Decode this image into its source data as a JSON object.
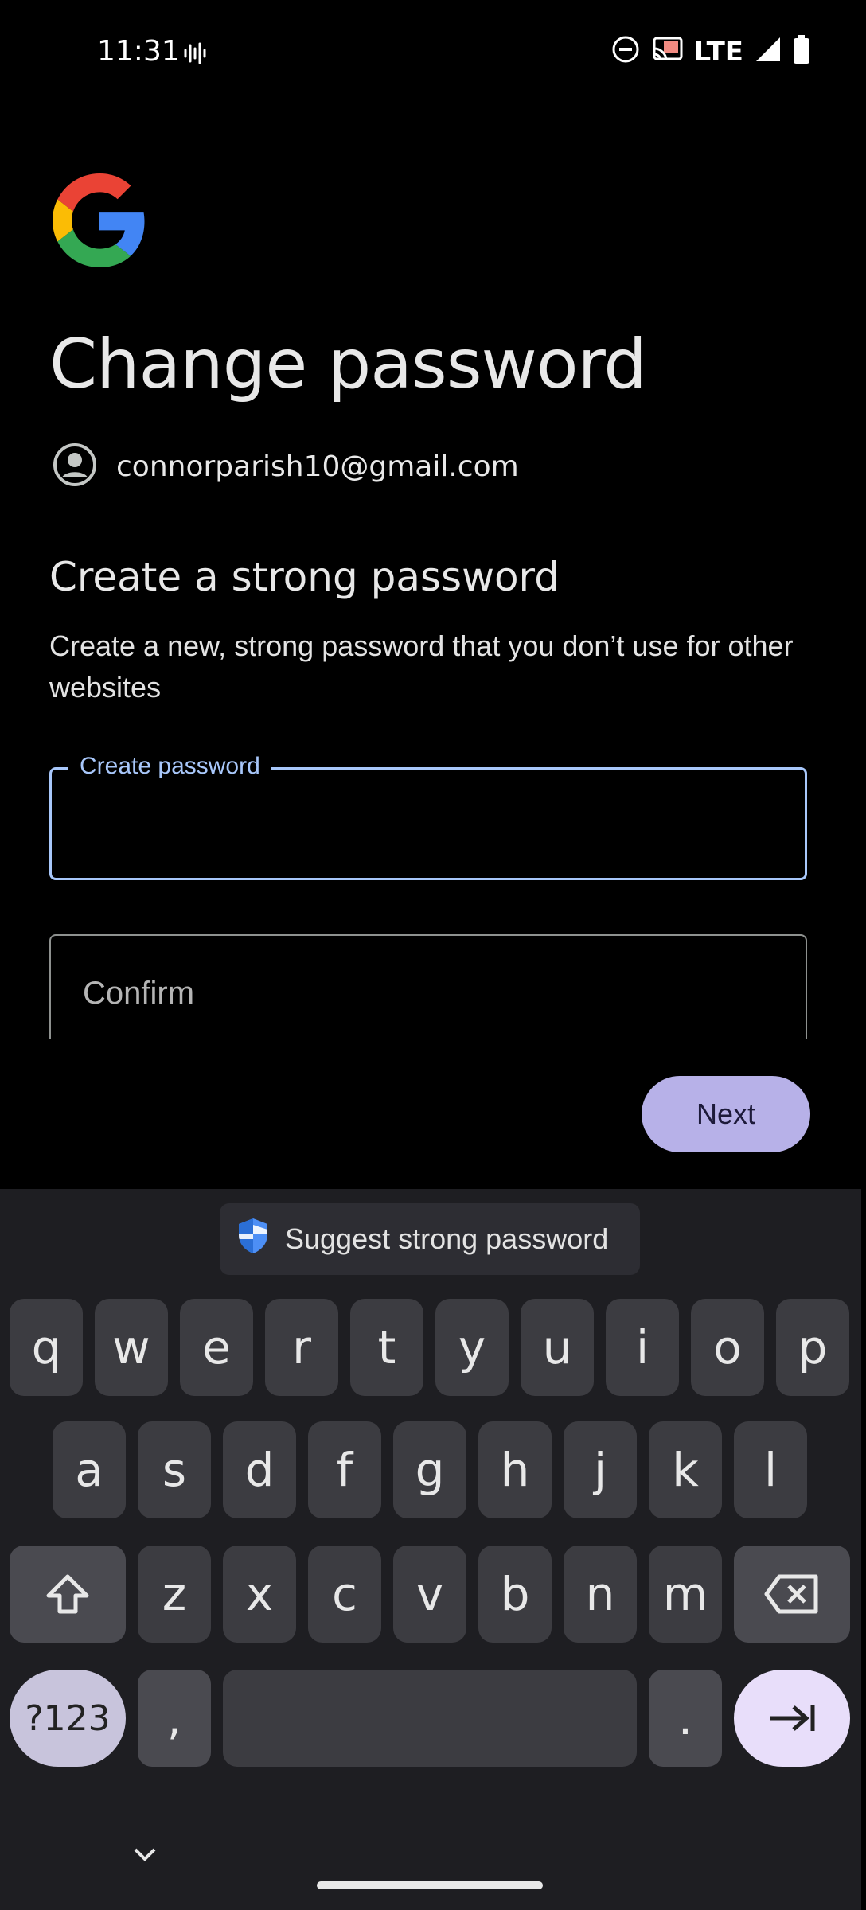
{
  "status": {
    "time": "11:31",
    "network": "LTE"
  },
  "header": {
    "title": "Change password",
    "email": "connorparish10@gmail.com",
    "subtitle": "Create a strong password",
    "description": "Create a new, strong password that you don’t use for other websites"
  },
  "form": {
    "create_label": "Create password",
    "confirm_placeholder": "Confirm",
    "next_label": "Next"
  },
  "keyboard": {
    "suggestion": "Suggest strong password",
    "row1": [
      "q",
      "w",
      "e",
      "r",
      "t",
      "y",
      "u",
      "i",
      "o",
      "p"
    ],
    "row2": [
      "a",
      "s",
      "d",
      "f",
      "g",
      "h",
      "j",
      "k",
      "l"
    ],
    "row3": [
      "z",
      "x",
      "c",
      "v",
      "b",
      "n",
      "m"
    ],
    "symbols_label": "?123",
    "comma": ",",
    "period": "."
  },
  "colors": {
    "accent": "#a8c7fa",
    "button": "#b7b1e8"
  }
}
